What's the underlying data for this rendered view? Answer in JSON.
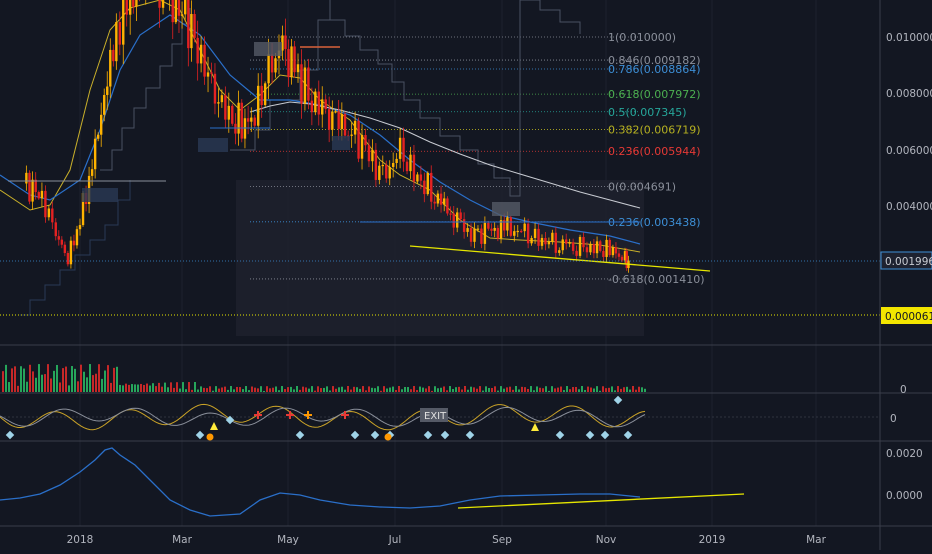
{
  "chart_data": {
    "type": "candlestick",
    "time_axis": [
      "2018",
      "Mar",
      "May",
      "Jul",
      "Sep",
      "Nov",
      "2019",
      "Mar"
    ],
    "price_axis": [
      "0.010000",
      "0.008000",
      "0.006000",
      "0.004000"
    ],
    "current_price": "0.001996",
    "horizontal_line_price": "0.000061",
    "ylim": [
      0.0,
      0.0108
    ],
    "fib_levels": [
      {
        "label": "1(0.010000)",
        "value": 0.01,
        "color": "#8a8f9a"
      },
      {
        "label": "0.846(0.009182)",
        "value": 0.009182,
        "color": "#8a8f9a"
      },
      {
        "label": "0.786(0.008864)",
        "value": 0.008864,
        "color": "#3d8fd6"
      },
      {
        "label": "0.618(0.007972)",
        "value": 0.007972,
        "color": "#4caf50"
      },
      {
        "label": "0.5(0.007345)",
        "value": 0.007345,
        "color": "#26a69a"
      },
      {
        "label": "0.382(0.006719)",
        "value": 0.006719,
        "color": "#b5b021"
      },
      {
        "label": "0.236(0.005944)",
        "value": 0.005944,
        "color": "#e53935"
      },
      {
        "label": "0(0.004691)",
        "value": 0.004691,
        "color": "#8a8f9a"
      },
      {
        "label": "0.236(0.003438)",
        "value": 0.003438,
        "color": "#3d8fd6"
      },
      {
        "label": "-0.618(0.001410)",
        "value": 0.00141,
        "color": "#8a8f9a"
      }
    ],
    "price_series": [
      [
        "2017-12-01",
        0.0048
      ],
      [
        "2017-12-10",
        0.0043
      ],
      [
        "2017-12-18",
        0.003
      ],
      [
        "2017-12-25",
        0.0021
      ],
      [
        "2018-01-01",
        0.0035
      ],
      [
        "2018-01-08",
        0.0055
      ],
      [
        "2018-01-15",
        0.008
      ],
      [
        "2018-01-22",
        0.0102
      ],
      [
        "2018-01-30",
        0.0118
      ],
      [
        "2018-02-08",
        0.0125
      ],
      [
        "2018-02-20",
        0.0115
      ],
      [
        "2018-03-01",
        0.0112
      ],
      [
        "2018-03-10",
        0.0096
      ],
      [
        "2018-03-20",
        0.008
      ],
      [
        "2018-03-30",
        0.007
      ],
      [
        "2018-04-10",
        0.0069
      ],
      [
        "2018-04-20",
        0.0088
      ],
      [
        "2018-04-28",
        0.0096
      ],
      [
        "2018-05-05",
        0.0088
      ],
      [
        "2018-05-15",
        0.0078
      ],
      [
        "2018-05-25",
        0.0073
      ],
      [
        "2018-06-05",
        0.0068
      ],
      [
        "2018-06-15",
        0.006
      ],
      [
        "2018-06-25",
        0.005
      ],
      [
        "2018-07-05",
        0.0059
      ],
      [
        "2018-07-15",
        0.005
      ],
      [
        "2018-07-25",
        0.0044
      ],
      [
        "2018-08-05",
        0.0037
      ],
      [
        "2018-08-15",
        0.003
      ],
      [
        "2018-08-25",
        0.0031
      ],
      [
        "2018-09-05",
        0.0032
      ],
      [
        "2018-09-15",
        0.003
      ],
      [
        "2018-09-25",
        0.0028
      ],
      [
        "2018-10-05",
        0.0027
      ],
      [
        "2018-10-15",
        0.0026
      ],
      [
        "2018-10-25",
        0.0025
      ],
      [
        "2018-11-05",
        0.0024
      ],
      [
        "2018-11-12",
        0.0021
      ],
      [
        "2018-11-15",
        0.002
      ]
    ],
    "indicator_axis": {
      "top": "0.0020",
      "bottom": "0.0000"
    },
    "oscillator_axis": "0",
    "volume_axis": "0",
    "labels": [
      "EXIT"
    ]
  }
}
